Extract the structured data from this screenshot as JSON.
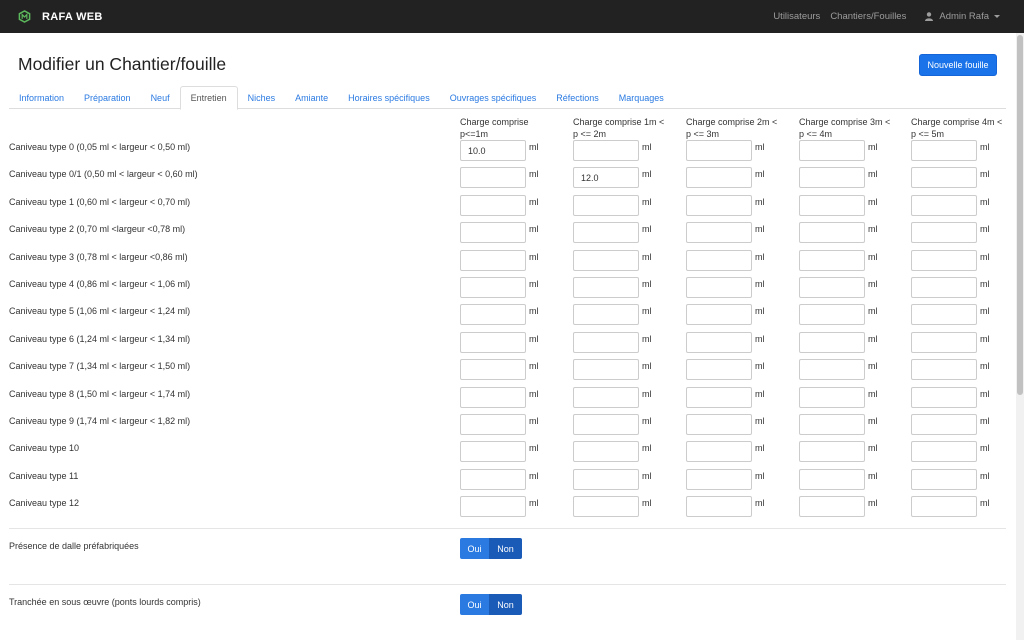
{
  "navbar": {
    "brand": "RAFA WEB",
    "links": [
      "Utilisateurs",
      "Chantiers/Fouilles"
    ],
    "user": "Admin Rafa"
  },
  "page": {
    "title": "Modifier un Chantier/fouille",
    "new_button": "Nouvelle fouille"
  },
  "tabs": [
    {
      "label": "Information"
    },
    {
      "label": "Préparation"
    },
    {
      "label": "Neuf"
    },
    {
      "label": "Entretien",
      "active": true
    },
    {
      "label": "Niches"
    },
    {
      "label": "Amiante"
    },
    {
      "label": "Horaires spécifiques"
    },
    {
      "label": "Ouvrages spécifiques"
    },
    {
      "label": "Réfections"
    },
    {
      "label": "Marquages"
    }
  ],
  "table": {
    "columns": [
      {
        "line1": "Charge comprise",
        "line2": "p<=1m"
      },
      {
        "line1": "Charge comprise 1m <",
        "line2": "p <= 2m"
      },
      {
        "line1": "Charge comprise 2m <",
        "line2": "p <= 3m"
      },
      {
        "line1": "Charge comprise 3m <",
        "line2": "p <= 4m"
      },
      {
        "line1": "Charge comprise 4m <",
        "line2": "p <= 5m"
      }
    ],
    "unit": "ml",
    "rows": [
      {
        "label": "Caniveau type 0 (0,05 ml < largeur < 0,50 ml)",
        "values": [
          "10.0",
          "",
          "",
          "",
          ""
        ]
      },
      {
        "label": "Caniveau type 0/1 (0,50 ml < largeur < 0,60 ml)",
        "values": [
          "",
          "12.0",
          "",
          "",
          ""
        ]
      },
      {
        "label": "Caniveau type 1 (0,60 ml < largeur < 0,70 ml)",
        "values": [
          "",
          "",
          "",
          "",
          ""
        ]
      },
      {
        "label": "Caniveau type 2 (0,70 ml <largeur <0,78 ml)",
        "values": [
          "",
          "",
          "",
          "",
          ""
        ]
      },
      {
        "label": "Caniveau type 3 (0,78 ml < largeur <0,86 ml)",
        "values": [
          "",
          "",
          "",
          "",
          ""
        ]
      },
      {
        "label": "Caniveau type 4 (0,86 ml < largeur < 1,06 ml)",
        "values": [
          "",
          "",
          "",
          "",
          ""
        ]
      },
      {
        "label": "Caniveau type 5 (1,06 ml < largeur < 1,24 ml)",
        "values": [
          "",
          "",
          "",
          "",
          ""
        ]
      },
      {
        "label": "Caniveau type 6 (1,24 ml < largeur < 1,34 ml)",
        "values": [
          "",
          "",
          "",
          "",
          ""
        ]
      },
      {
        "label": "Caniveau type 7 (1,34 ml < largeur < 1,50 ml)",
        "values": [
          "",
          "",
          "",
          "",
          ""
        ]
      },
      {
        "label": "Caniveau type 8 (1,50 ml < largeur < 1,74 ml)",
        "values": [
          "",
          "",
          "",
          "",
          ""
        ]
      },
      {
        "label": "Caniveau type 9 (1,74 ml < largeur < 1,82 ml)",
        "values": [
          "",
          "",
          "",
          "",
          ""
        ]
      },
      {
        "label": "Caniveau type 10",
        "values": [
          "",
          "",
          "",
          "",
          ""
        ]
      },
      {
        "label": "Caniveau type 11",
        "values": [
          "",
          "",
          "",
          "",
          ""
        ]
      },
      {
        "label": "Caniveau type 12",
        "values": [
          "",
          "",
          "",
          "",
          ""
        ]
      }
    ]
  },
  "toggles": [
    {
      "label": "Présence de dalle préfabriquées",
      "oui": "Oui",
      "non": "Non"
    },
    {
      "label": "Tranchée en sous œuvre (ponts lourds compris)",
      "oui": "Oui",
      "non": "Non"
    }
  ],
  "colors": {
    "navbar_bg": "#222222",
    "accent": "#2a7ae2",
    "primary_button": "#1a73e8",
    "brand_icon": "#5cb85c"
  },
  "icons": {
    "brand": "hexagon-logo-icon",
    "user": "user-icon",
    "dropdown": "caret-down-icon"
  }
}
